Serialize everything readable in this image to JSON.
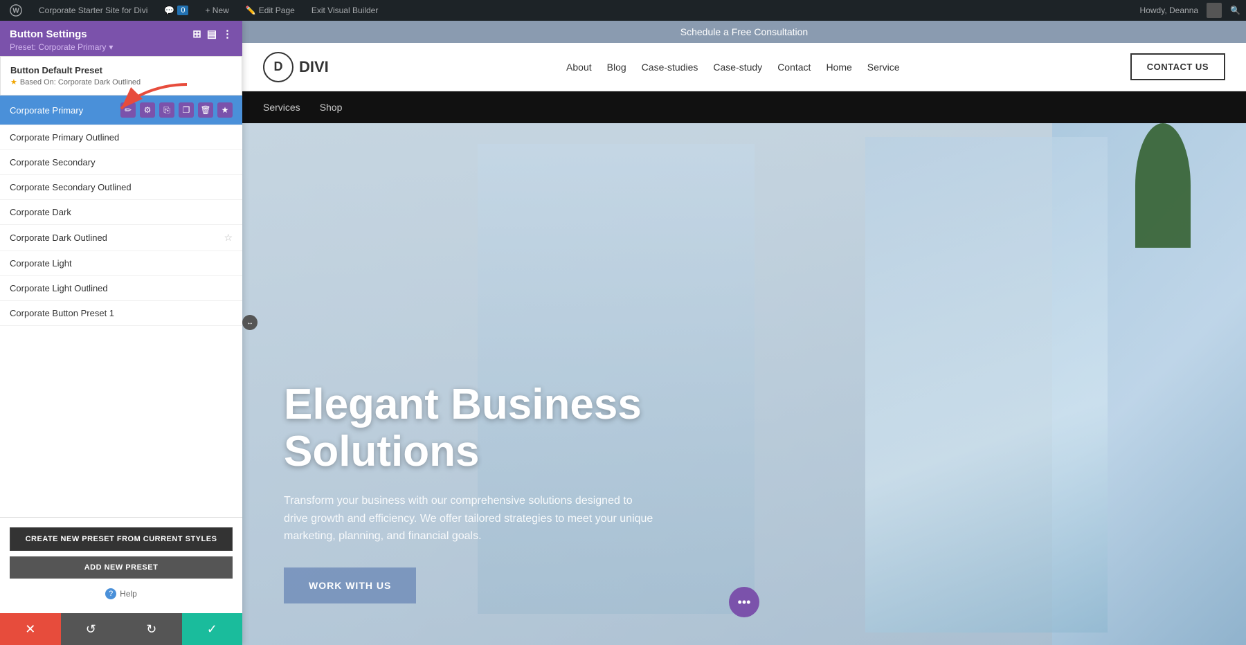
{
  "adminBar": {
    "wpIcon": "wordpress-icon",
    "siteName": "Corporate Starter Site for Divi",
    "commentCount": "0",
    "newLabel": "+ New",
    "editPageLabel": "Edit Page",
    "exitBuilderLabel": "Exit Visual Builder",
    "userGreeting": "Howdy, Deanna",
    "searchIcon": "search-icon"
  },
  "panel": {
    "title": "Button Settings",
    "presetLabel": "Preset: Corporate Primary",
    "presetDropdownIcon": "chevron-down-icon",
    "windowIcons": [
      "window-icon",
      "layout-icon",
      "more-icon"
    ],
    "defaultPreset": {
      "title": "Button Default Preset",
      "basedOn": "Based On: Corporate Dark Outlined",
      "starIcon": "star-icon"
    },
    "presets": [
      {
        "id": "corporate-primary",
        "name": "Corporate Primary",
        "active": true,
        "actions": [
          "edit",
          "settings",
          "copy",
          "duplicate",
          "delete",
          "star-active"
        ]
      },
      {
        "id": "corporate-primary-outlined",
        "name": "Corporate Primary Outlined",
        "active": false,
        "actions": []
      },
      {
        "id": "corporate-secondary",
        "name": "Corporate Secondary",
        "active": false,
        "actions": []
      },
      {
        "id": "corporate-secondary-outlined",
        "name": "Corporate Secondary Outlined",
        "active": false,
        "actions": []
      },
      {
        "id": "corporate-dark",
        "name": "Corporate Dark",
        "active": false,
        "actions": []
      },
      {
        "id": "corporate-dark-outlined",
        "name": "Corporate Dark Outlined",
        "active": false,
        "hasStar": true
      },
      {
        "id": "corporate-light",
        "name": "Corporate Light",
        "active": false,
        "actions": []
      },
      {
        "id": "corporate-light-outlined",
        "name": "Corporate Light Outlined",
        "active": false,
        "actions": []
      },
      {
        "id": "corporate-button-preset-1",
        "name": "Corporate Button Preset 1",
        "active": false,
        "actions": []
      }
    ],
    "createPresetBtn": "CREATE NEW PRESET FROM CURRENT STYLES",
    "addPresetBtn": "ADD NEW PRESET",
    "helpLabel": "Help"
  },
  "bottomToolbar": {
    "cancelIcon": "✕",
    "undoIcon": "↺",
    "redoIcon": "↻",
    "saveIcon": "✓"
  },
  "website": {
    "announcementBar": "Schedule a Free Consultation",
    "logo": "DIVI",
    "navLinks": [
      "About",
      "Blog",
      "Case-studies",
      "Case-study",
      "Contact",
      "Home",
      "Service"
    ],
    "contactBtn": "CONTACT US",
    "subNavLinks": [
      "Services",
      "Shop"
    ],
    "hero": {
      "title": "Elegant Business Solutions",
      "subtitle": "Transform your business with our comprehensive solutions designed to drive growth and efficiency. We offer tailored strategies to meet your unique marketing, planning, and financial goals.",
      "ctaBtn": "WORK WITH US"
    }
  }
}
